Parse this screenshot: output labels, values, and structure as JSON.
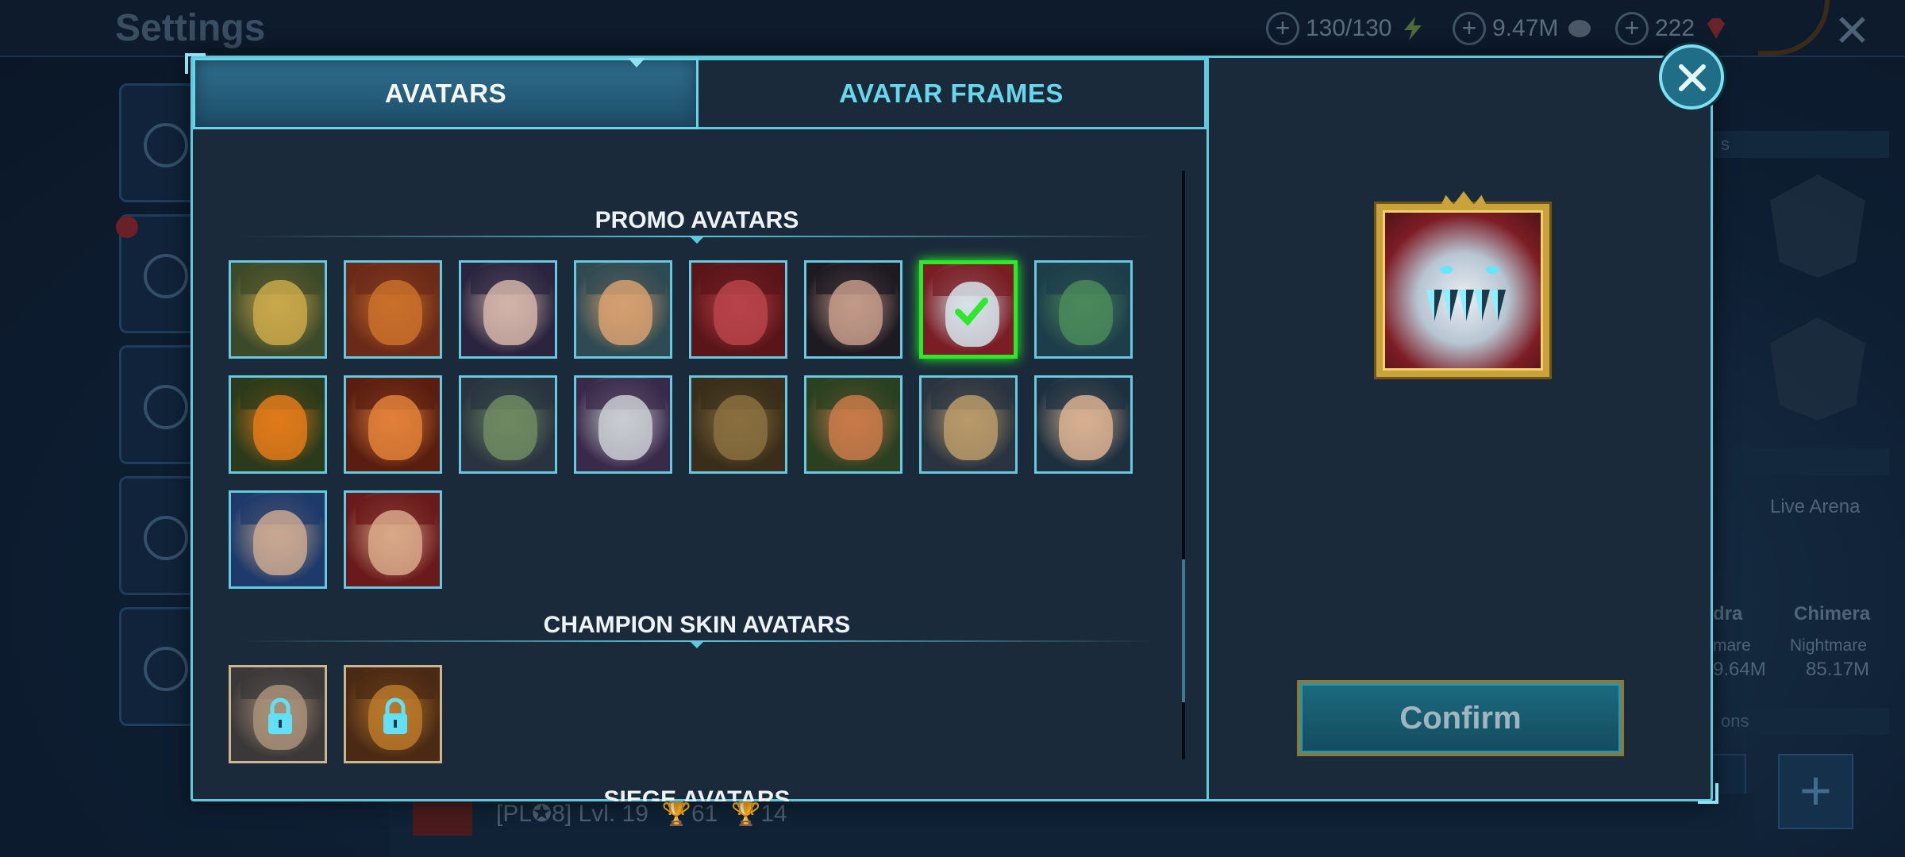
{
  "background": {
    "title": "Settings",
    "resources": [
      {
        "value": "130/130",
        "icon": "energy-icon"
      },
      {
        "value": "9.47M",
        "icon": "silver-icon"
      },
      {
        "value": "222",
        "icon": "gem-icon"
      }
    ],
    "right_panel": {
      "live_arena": "Live Arena",
      "hydra": "dra",
      "chimera": "Chimera",
      "difficulty_hydra": "mare",
      "difficulty_chimera": "Nightmare",
      "score_hydra": "9.64M",
      "score_chimera": "85.17M",
      "header_top": "s",
      "header_bottom": "ons"
    },
    "player_bar": {
      "clan": "[PL✪8]",
      "level": "Lvl. 19",
      "trophies": "61",
      "cups": "14"
    }
  },
  "modal": {
    "tabs": [
      {
        "label": "AVATARS",
        "active": true
      },
      {
        "label": "AVATAR FRAMES",
        "active": false
      }
    ],
    "sections": [
      {
        "title": "PROMO AVATARS"
      },
      {
        "title": "CHAMPION SKIN AVATARS"
      },
      {
        "title": "SIEGE AVATARS"
      }
    ],
    "promo_avatars": [
      {
        "name": "avatar-gold-masked-warrior",
        "colors": [
          "#3d4a2a",
          "#c9a84a"
        ]
      },
      {
        "name": "avatar-tribal-chief",
        "colors": [
          "#6b2a18",
          "#c9702a"
        ]
      },
      {
        "name": "avatar-dark-haired-woman",
        "colors": [
          "#2a2440",
          "#d2b4a8"
        ]
      },
      {
        "name": "avatar-cyan-crowned-elf",
        "colors": [
          "#2f4a52",
          "#d6a070"
        ]
      },
      {
        "name": "avatar-red-armored-knight",
        "colors": [
          "#5a1518",
          "#b8434a"
        ]
      },
      {
        "name": "avatar-noble-lady",
        "colors": [
          "#1e1a22",
          "#c39a88"
        ]
      },
      {
        "name": "avatar-frost-beast",
        "colors": [
          "#7a1d24",
          "#d6e2ea"
        ],
        "selected": true
      },
      {
        "name": "avatar-horned-druid",
        "colors": [
          "#1d3d4a",
          "#4a8a5a"
        ]
      },
      {
        "name": "avatar-pumpkin-head",
        "colors": [
          "#2a3a1a",
          "#e07a1a"
        ]
      },
      {
        "name": "avatar-fire-demon",
        "colors": [
          "#5a1e10",
          "#e0803a"
        ]
      },
      {
        "name": "avatar-green-orc",
        "colors": [
          "#2a3440",
          "#6f8a62"
        ]
      },
      {
        "name": "avatar-silver-helmet-knight",
        "colors": [
          "#3a2a4a",
          "#c9ccd2"
        ]
      },
      {
        "name": "avatar-goblin-warrior",
        "colors": [
          "#3a2e1a",
          "#8a7040"
        ]
      },
      {
        "name": "avatar-leprechaun-dwarf",
        "colors": [
          "#2a4020",
          "#c97a4a"
        ]
      },
      {
        "name": "avatar-gold-crown-warlord",
        "colors": [
          "#2a3440",
          "#b89a6a"
        ]
      },
      {
        "name": "avatar-elven-maiden",
        "colors": [
          "#1e3040",
          "#d8b090"
        ]
      },
      {
        "name": "avatar-tattooed-warrior",
        "colors": [
          "#1e3a6a",
          "#c9a890"
        ]
      },
      {
        "name": "avatar-red-haired-queen",
        "colors": [
          "#6a1a1a",
          "#d8a888"
        ]
      }
    ],
    "skin_avatars": [
      {
        "name": "avatar-locked-priestess",
        "colors": [
          "#3a3838",
          "#a89078"
        ],
        "locked": true
      },
      {
        "name": "avatar-locked-beastman",
        "colors": [
          "#4a2a14",
          "#b8782a"
        ],
        "locked": true
      }
    ],
    "confirm_label": "Confirm"
  }
}
